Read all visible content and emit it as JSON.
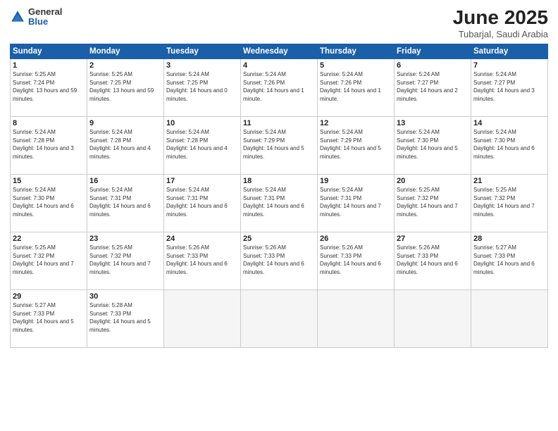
{
  "logo": {
    "general": "General",
    "blue": "Blue"
  },
  "title": {
    "month": "June 2025",
    "location": "Tubarjal, Saudi Arabia"
  },
  "weekdays": [
    "Sunday",
    "Monday",
    "Tuesday",
    "Wednesday",
    "Thursday",
    "Friday",
    "Saturday"
  ],
  "weeks": [
    [
      {
        "day": "1",
        "sunrise": "Sunrise: 5:25 AM",
        "sunset": "Sunset: 7:24 PM",
        "daylight": "Daylight: 13 hours and 59 minutes."
      },
      {
        "day": "2",
        "sunrise": "Sunrise: 5:25 AM",
        "sunset": "Sunset: 7:25 PM",
        "daylight": "Daylight: 13 hours and 59 minutes."
      },
      {
        "day": "3",
        "sunrise": "Sunrise: 5:24 AM",
        "sunset": "Sunset: 7:25 PM",
        "daylight": "Daylight: 14 hours and 0 minutes."
      },
      {
        "day": "4",
        "sunrise": "Sunrise: 5:24 AM",
        "sunset": "Sunset: 7:26 PM",
        "daylight": "Daylight: 14 hours and 1 minute."
      },
      {
        "day": "5",
        "sunrise": "Sunrise: 5:24 AM",
        "sunset": "Sunset: 7:26 PM",
        "daylight": "Daylight: 14 hours and 1 minute."
      },
      {
        "day": "6",
        "sunrise": "Sunrise: 5:24 AM",
        "sunset": "Sunset: 7:27 PM",
        "daylight": "Daylight: 14 hours and 2 minutes."
      },
      {
        "day": "7",
        "sunrise": "Sunrise: 5:24 AM",
        "sunset": "Sunset: 7:27 PM",
        "daylight": "Daylight: 14 hours and 3 minutes."
      }
    ],
    [
      {
        "day": "8",
        "sunrise": "Sunrise: 5:24 AM",
        "sunset": "Sunset: 7:28 PM",
        "daylight": "Daylight: 14 hours and 3 minutes."
      },
      {
        "day": "9",
        "sunrise": "Sunrise: 5:24 AM",
        "sunset": "Sunset: 7:28 PM",
        "daylight": "Daylight: 14 hours and 4 minutes."
      },
      {
        "day": "10",
        "sunrise": "Sunrise: 5:24 AM",
        "sunset": "Sunset: 7:28 PM",
        "daylight": "Daylight: 14 hours and 4 minutes."
      },
      {
        "day": "11",
        "sunrise": "Sunrise: 5:24 AM",
        "sunset": "Sunset: 7:29 PM",
        "daylight": "Daylight: 14 hours and 5 minutes."
      },
      {
        "day": "12",
        "sunrise": "Sunrise: 5:24 AM",
        "sunset": "Sunset: 7:29 PM",
        "daylight": "Daylight: 14 hours and 5 minutes."
      },
      {
        "day": "13",
        "sunrise": "Sunrise: 5:24 AM",
        "sunset": "Sunset: 7:30 PM",
        "daylight": "Daylight: 14 hours and 5 minutes."
      },
      {
        "day": "14",
        "sunrise": "Sunrise: 5:24 AM",
        "sunset": "Sunset: 7:30 PM",
        "daylight": "Daylight: 14 hours and 6 minutes."
      }
    ],
    [
      {
        "day": "15",
        "sunrise": "Sunrise: 5:24 AM",
        "sunset": "Sunset: 7:30 PM",
        "daylight": "Daylight: 14 hours and 6 minutes."
      },
      {
        "day": "16",
        "sunrise": "Sunrise: 5:24 AM",
        "sunset": "Sunset: 7:31 PM",
        "daylight": "Daylight: 14 hours and 6 minutes."
      },
      {
        "day": "17",
        "sunrise": "Sunrise: 5:24 AM",
        "sunset": "Sunset: 7:31 PM",
        "daylight": "Daylight: 14 hours and 6 minutes."
      },
      {
        "day": "18",
        "sunrise": "Sunrise: 5:24 AM",
        "sunset": "Sunset: 7:31 PM",
        "daylight": "Daylight: 14 hours and 6 minutes."
      },
      {
        "day": "19",
        "sunrise": "Sunrise: 5:24 AM",
        "sunset": "Sunset: 7:31 PM",
        "daylight": "Daylight: 14 hours and 7 minutes."
      },
      {
        "day": "20",
        "sunrise": "Sunrise: 5:25 AM",
        "sunset": "Sunset: 7:32 PM",
        "daylight": "Daylight: 14 hours and 7 minutes."
      },
      {
        "day": "21",
        "sunrise": "Sunrise: 5:25 AM",
        "sunset": "Sunset: 7:32 PM",
        "daylight": "Daylight: 14 hours and 7 minutes."
      }
    ],
    [
      {
        "day": "22",
        "sunrise": "Sunrise: 5:25 AM",
        "sunset": "Sunset: 7:32 PM",
        "daylight": "Daylight: 14 hours and 7 minutes."
      },
      {
        "day": "23",
        "sunrise": "Sunrise: 5:25 AM",
        "sunset": "Sunset: 7:32 PM",
        "daylight": "Daylight: 14 hours and 7 minutes."
      },
      {
        "day": "24",
        "sunrise": "Sunrise: 5:26 AM",
        "sunset": "Sunset: 7:33 PM",
        "daylight": "Daylight: 14 hours and 6 minutes."
      },
      {
        "day": "25",
        "sunrise": "Sunrise: 5:26 AM",
        "sunset": "Sunset: 7:33 PM",
        "daylight": "Daylight: 14 hours and 6 minutes."
      },
      {
        "day": "26",
        "sunrise": "Sunrise: 5:26 AM",
        "sunset": "Sunset: 7:33 PM",
        "daylight": "Daylight: 14 hours and 6 minutes."
      },
      {
        "day": "27",
        "sunrise": "Sunrise: 5:26 AM",
        "sunset": "Sunset: 7:33 PM",
        "daylight": "Daylight: 14 hours and 6 minutes."
      },
      {
        "day": "28",
        "sunrise": "Sunrise: 5:27 AM",
        "sunset": "Sunset: 7:33 PM",
        "daylight": "Daylight: 14 hours and 6 minutes."
      }
    ],
    [
      {
        "day": "29",
        "sunrise": "Sunrise: 5:27 AM",
        "sunset": "Sunset: 7:33 PM",
        "daylight": "Daylight: 14 hours and 5 minutes."
      },
      {
        "day": "30",
        "sunrise": "Sunrise: 5:28 AM",
        "sunset": "Sunset: 7:33 PM",
        "daylight": "Daylight: 14 hours and 5 minutes."
      },
      null,
      null,
      null,
      null,
      null
    ]
  ]
}
